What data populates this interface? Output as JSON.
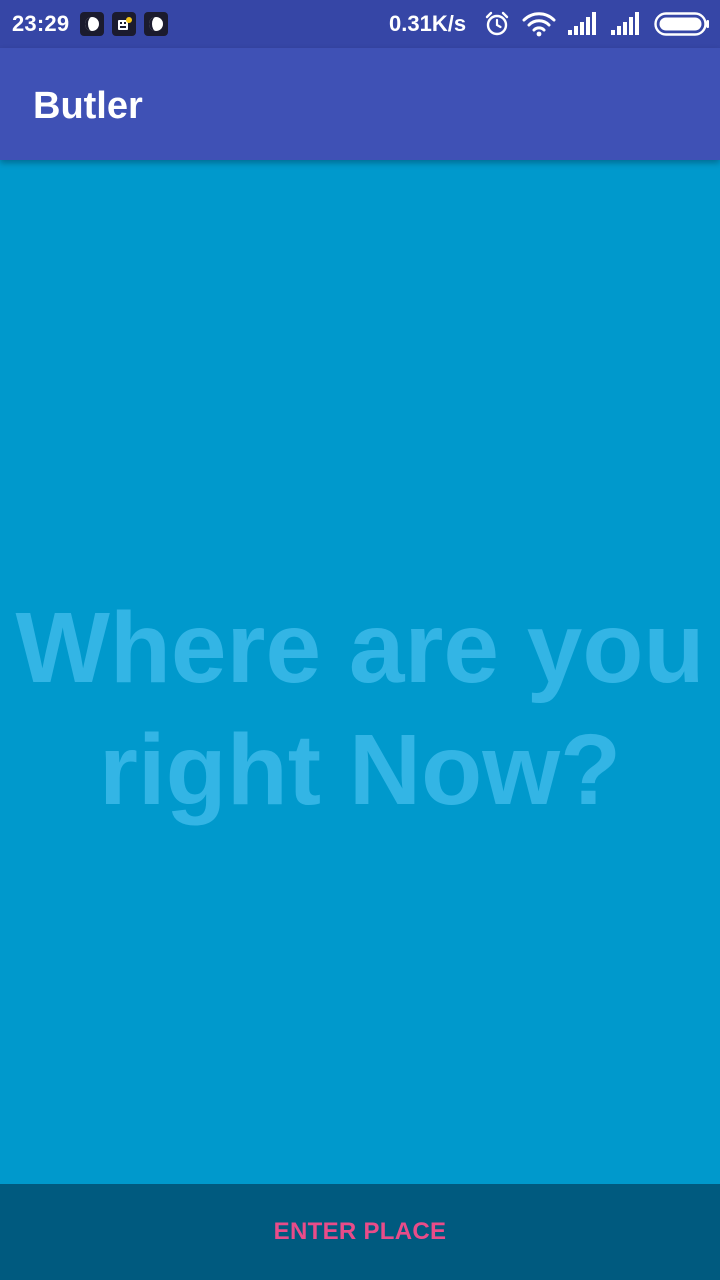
{
  "status_bar": {
    "time": "23:29",
    "network_speed": "0.31K/s",
    "notification_icons": [
      "moon-app-icon",
      "keyboard-app-icon",
      "moon-app-icon"
    ],
    "system_icons": [
      "alarm-icon",
      "wifi-icon",
      "signal-icon",
      "signal-icon",
      "battery-icon"
    ],
    "color": "#3646A6"
  },
  "app_bar": {
    "title": "Butler",
    "color": "#3F51B5"
  },
  "main": {
    "prompt_line1": "Where are you",
    "prompt_line2": "right Now?",
    "background_color": "#0099CC",
    "prompt_color": "#33B5E5"
  },
  "bottom_bar": {
    "button_label": "ENTER PLACE",
    "background_color": "#005A7F",
    "button_color": "#E94C89"
  }
}
